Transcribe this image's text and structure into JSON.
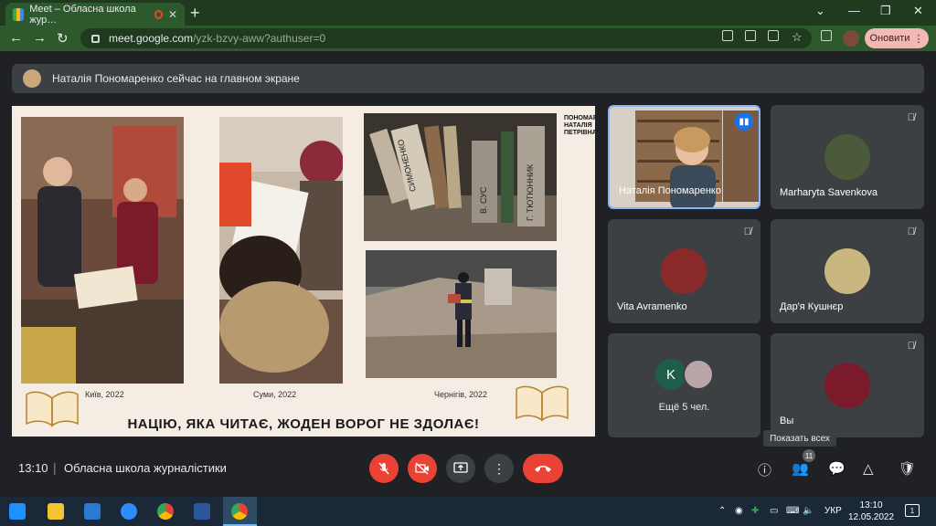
{
  "browser": {
    "tab_title": "Meet – Обласна школа жур…",
    "tab_close": "✕",
    "new_tab": "+",
    "url_host": "meet.google.com",
    "url_path": "/yzk-bzvy-aww?authuser=0",
    "refresh_label": "Оновити",
    "window_controls": [
      "⌄",
      "—",
      "❐",
      "✕"
    ]
  },
  "banner": {
    "text": "Наталія Пономаренко сейчас на главном экране"
  },
  "slide": {
    "brand": "ПОНОМАРЕНКО\nНАТАЛІЯ\nПЕТРІВНА",
    "captions": [
      "Київ, 2022",
      "Суми, 2022",
      "Чернігів, 2022"
    ],
    "book_spines": [
      "СИМОНЕНКО",
      "В. СУС",
      "Г. ТЮТЮННИК"
    ],
    "slogan": "НАЦІЮ, ЯКА ЧИТАЄ, ЖОДЕН ВОРОГ НЕ ЗДОЛАЄ!"
  },
  "participants": [
    {
      "name": "Наталія Пономаренко",
      "speaking": true
    },
    {
      "name": "Marharyta Savenkova",
      "muted": true
    },
    {
      "name": "Vita Avramenko",
      "muted": true
    },
    {
      "name": "Дар'я Кушнєр",
      "muted": true
    },
    {
      "name": "Ещё 5 чел.",
      "initial": "K"
    },
    {
      "name": "Вы",
      "muted": true
    }
  ],
  "tooltip": "Показать всех",
  "meeting": {
    "time": "13:10",
    "separator": "|",
    "title": "Обласна школа журналістики",
    "people_count": "11"
  },
  "taskbar": {
    "language": "УКР",
    "time": "13:10",
    "date": "12.05.2022",
    "notifications": "1"
  },
  "colors": {
    "end_call": "#ea4335",
    "speaker_border": "#8ab4f8",
    "browser_frame": "#2d5a2d"
  }
}
